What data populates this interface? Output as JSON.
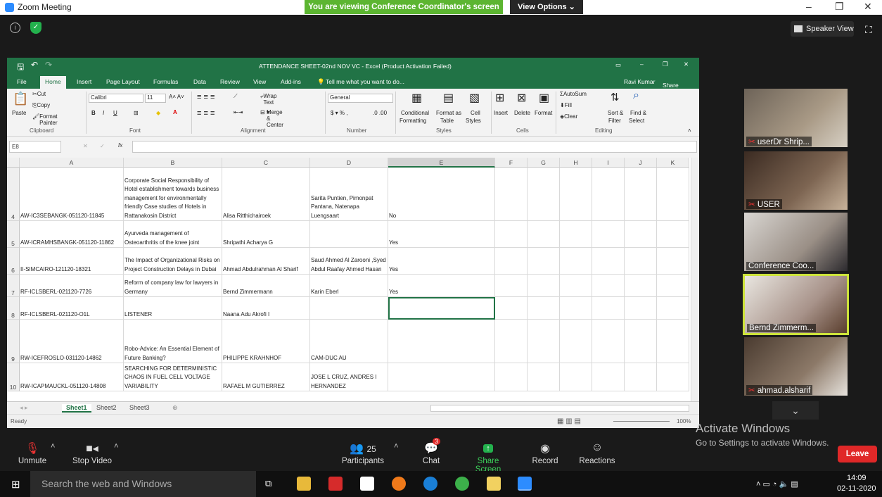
{
  "zoom": {
    "title": "Zoom Meeting",
    "viewing_banner": "You are viewing Conference Coordinator's screen",
    "view_options": "View Options",
    "speaker_view": "Speaker View",
    "participants_count": "25",
    "chat_badge": "3",
    "toolbar": {
      "unmute": "Unmute",
      "stop_video": "Stop Video",
      "participants": "Participants",
      "chat": "Chat",
      "share_screen": "Share Screen",
      "record": "Record",
      "reactions": "Reactions",
      "leave": "Leave"
    },
    "tiles": [
      "userDr Shrip...",
      "USER",
      "Conference Coo...",
      "Bernd Zimmerm...",
      "ahmad.alsharif"
    ],
    "activate_title": "Activate Windows",
    "activate_sub": "Go to Settings to activate Windows."
  },
  "excel": {
    "title": "ATTENDANCE SHEET-02nd NOV VC - Excel (Product Activation Failed)",
    "tabs": [
      "File",
      "Home",
      "Insert",
      "Page Layout",
      "Formulas",
      "Data",
      "Review",
      "View",
      "Add-ins"
    ],
    "tell_me": "Tell me what you want to do...",
    "user": "Ravi Kumar",
    "share": "Share",
    "ribbon": {
      "cut": "Cut",
      "copy": "Copy",
      "format_painter": "Format Painter",
      "paste": "Paste",
      "font": "Calibri",
      "size": "11",
      "wrap": "Wrap Text",
      "merge": "Merge & Center",
      "number_format": "General",
      "conditional": "Conditional",
      "formatting": "Formatting",
      "format_as": "Format as",
      "table": "Table",
      "cell": "Cell",
      "styles_btn": "Styles",
      "insert": "Insert",
      "delete": "Delete",
      "format": "Format",
      "autosum": "AutoSum",
      "fill": "Fill",
      "clear": "Clear",
      "sort": "Sort &",
      "filter": "Filter",
      "find": "Find &",
      "select": "Select",
      "groups": [
        "Clipboard",
        "Font",
        "Alignment",
        "Number",
        "Styles",
        "Cells",
        "Editing"
      ]
    },
    "name_box": "E8",
    "columns": [
      "A",
      "B",
      "C",
      "D",
      "E",
      "F",
      "G",
      "H",
      "I",
      "J",
      "K"
    ],
    "rows": [
      {
        "n": "4",
        "a": "AW-IC3SEBANGK-051120-11845",
        "b": "Corporate Social Responsibility of Hotel establishment towards business management for environmentally friendly Case studies of Hotels in Rattanakosin District",
        "c": "Alisa Ritthichairoek",
        "d": "Sarita Puntien, Pimonpat Pantana, Natenapa Luengsaart",
        "e": "No"
      },
      {
        "n": "5",
        "a": "AW-ICRAMHSBANGK-051120-11862",
        "b": "Ayurveda management of Osteoarthritis of the knee joint",
        "c": "Shripathi Acharya G",
        "d": "",
        "e": "Yes"
      },
      {
        "n": "6",
        "a": "II-SIMCAIRO-121120-18321",
        "b": "The Impact of Organizational Risks on Project Construction Delays in Dubai",
        "c": "Ahmad Abdulrahman Al Sharif",
        "d": "Saud Ahmed Al Zarooni ,Syed Abdul Raafay Ahmed Hasan",
        "e": "Yes"
      },
      {
        "n": "7",
        "a": "RF-ICLSBERL-021120-7726",
        "b": "Reform of company law for lawyers in Germany",
        "c": "Bernd Zimmermann",
        "d": "Karin Eberl",
        "e": "Yes"
      },
      {
        "n": "8",
        "a": "RF-ICLSBERL-021120-O1L",
        "b": "LISTENER",
        "c": "Naana Adu Akrofi I",
        "d": "",
        "e": ""
      },
      {
        "n": "9",
        "a": "RW-ICEFROSLO-031120-14862",
        "b": "Robo-Advice: An Essential Element of Future Banking?",
        "c": "PHILIPPE KRAHNHOF",
        "d": "CAM-DUC AU",
        "e": ""
      },
      {
        "n": "10",
        "a": "RW-ICAPMAUCKL-051120-14808",
        "b": "SEARCHING FOR DETERMINISTIC CHAOS IN FUEL CELL VOLTAGE VARIABILITY",
        "c": "RAFAEL M GUTIERREZ",
        "d": "JOSE L CRUZ, ANDRES I HERNANDEZ",
        "e": ""
      }
    ],
    "sheets": [
      "Sheet1",
      "Sheet2",
      "Sheet3"
    ],
    "status": "Ready",
    "zoom_level": "100%"
  },
  "taskbar": {
    "search": "Search the web and Windows",
    "time": "14:09",
    "date": "02-11-2020"
  }
}
